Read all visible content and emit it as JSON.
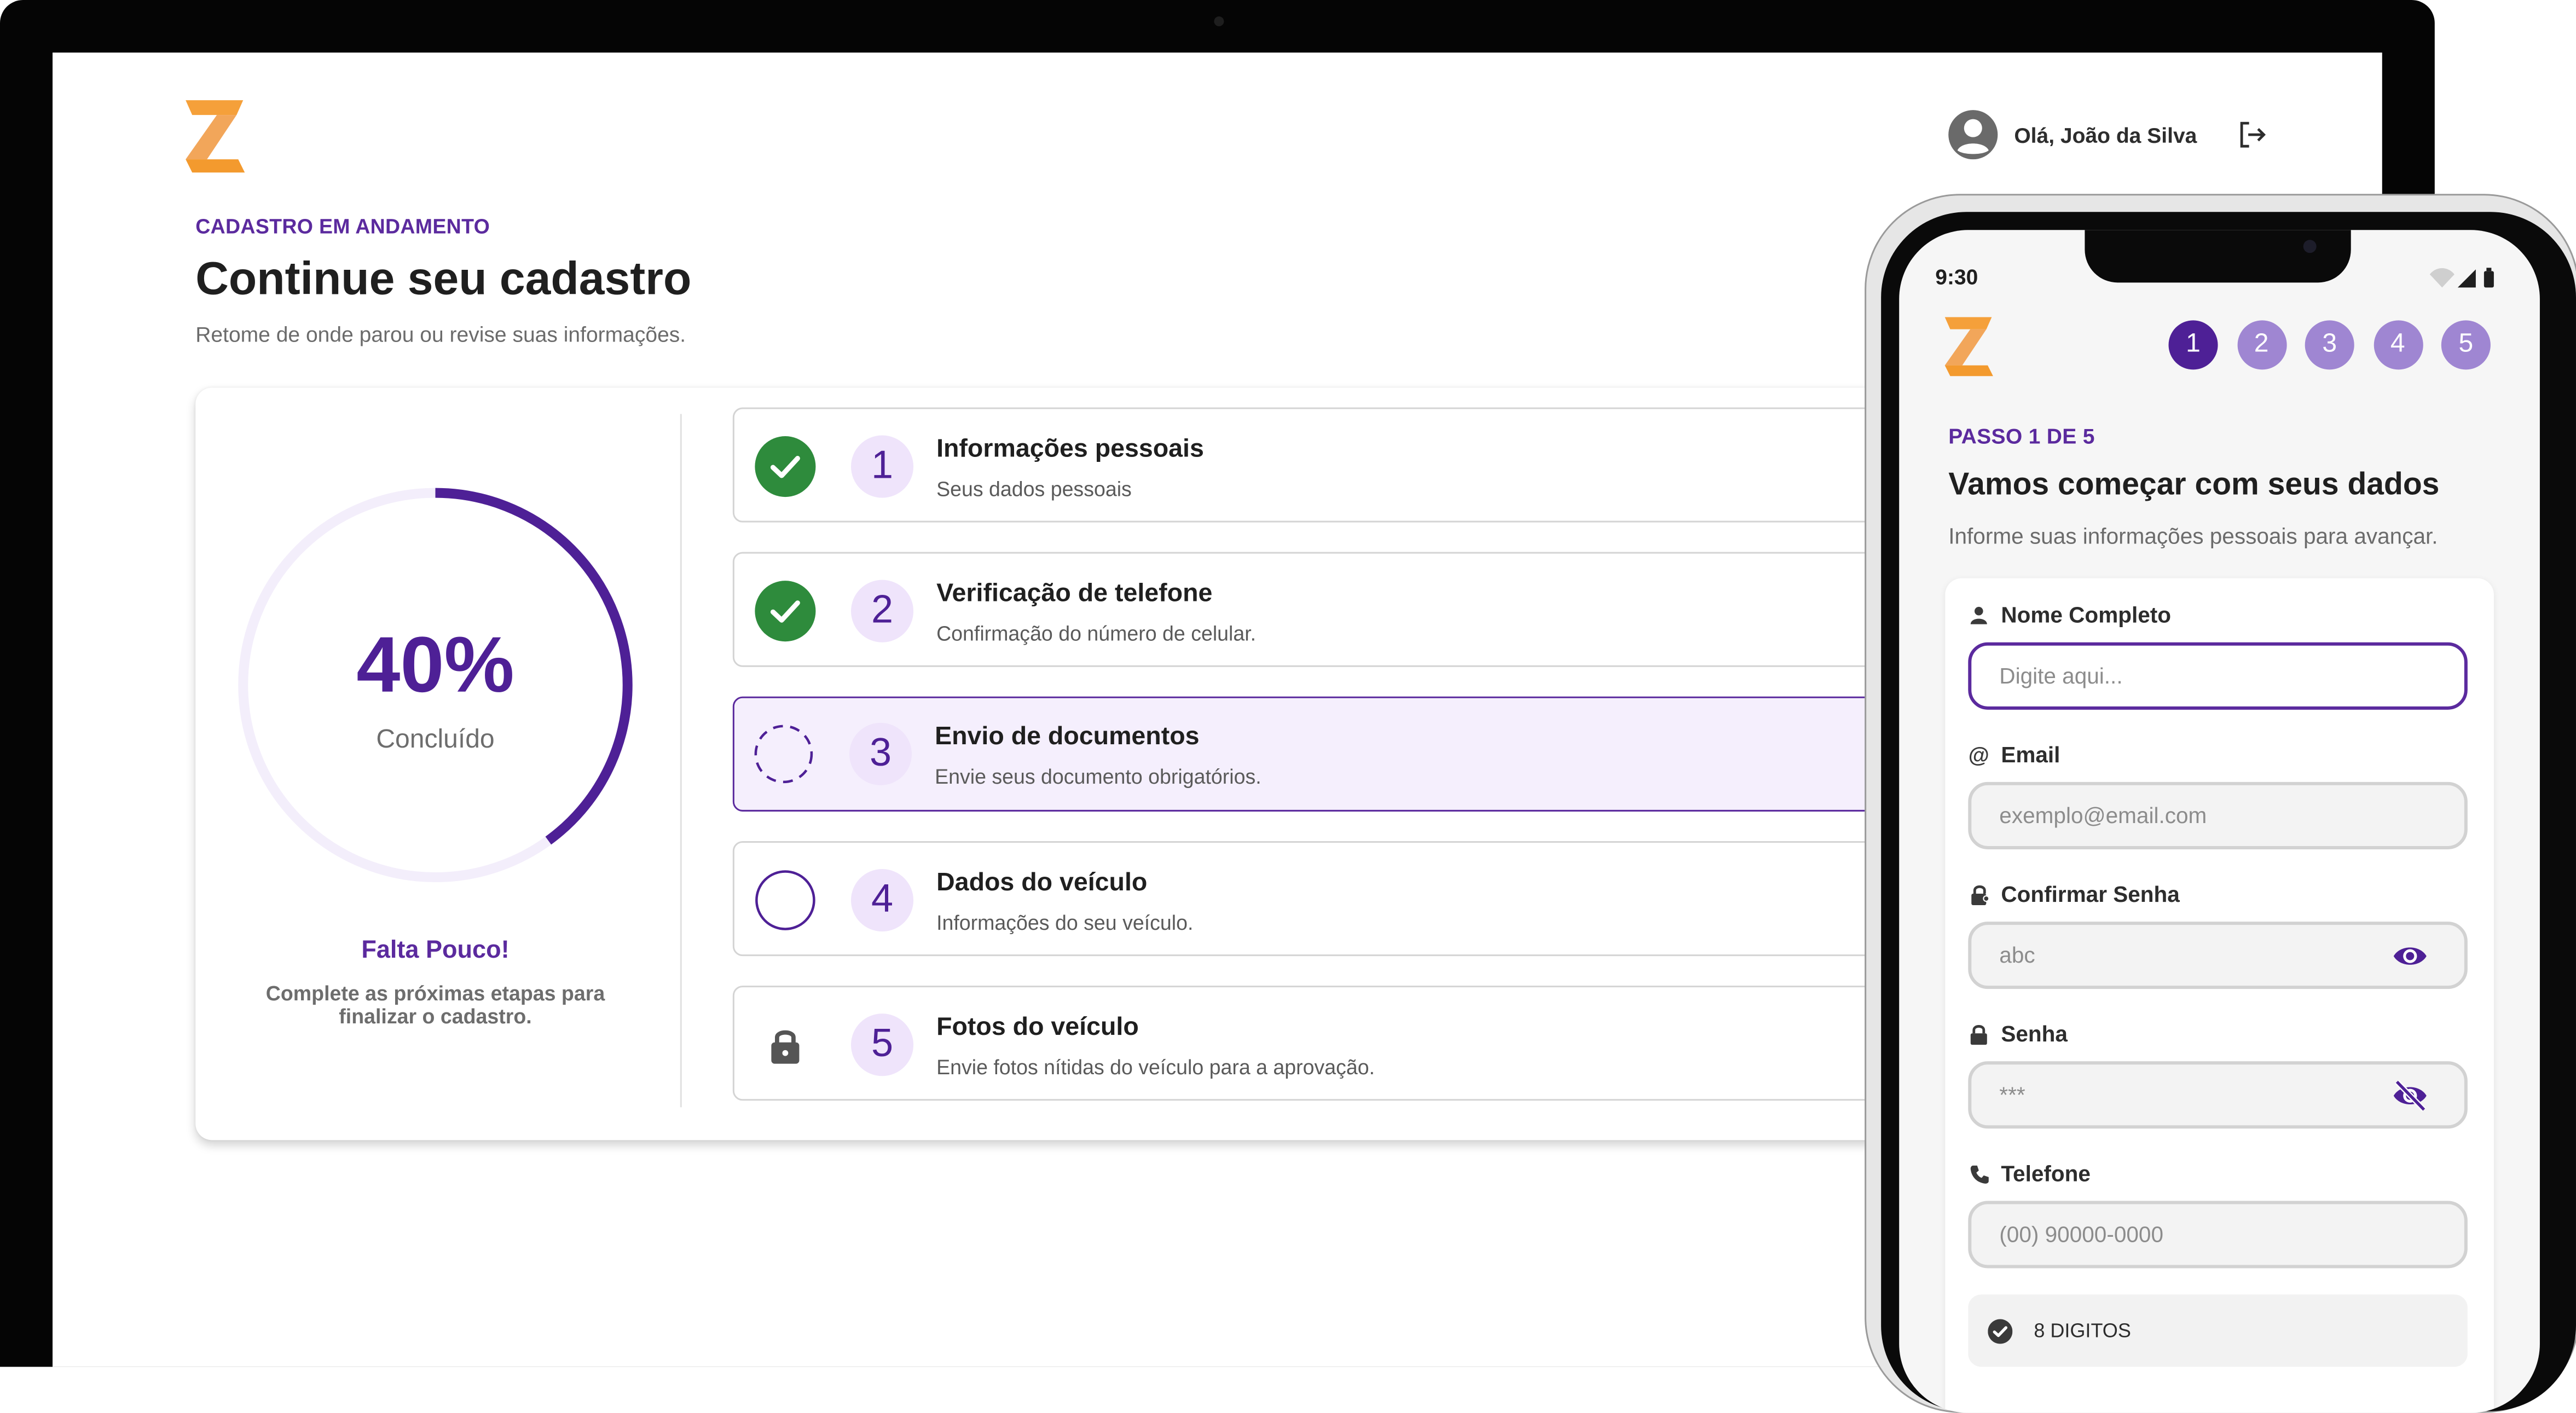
{
  "header": {
    "greeting": "Olá, João da Silva"
  },
  "desktop": {
    "eyebrow": "CADASTRO EM ANDAMENTO",
    "title": "Continue seu cadastro",
    "subtitle": "Retome de onde parou ou revise suas informações.",
    "progress": {
      "percent": 40,
      "percent_text": "40%",
      "label": "Concluído"
    },
    "encouragement": {
      "title": "Falta Pouco!",
      "text": "Complete as próximas etapas para finalizar o cadastro."
    },
    "steps": [
      {
        "num": "1",
        "title": "Informações pessoais",
        "desc": "Seus dados pessoais",
        "status": "done"
      },
      {
        "num": "2",
        "title": "Verificação de telefone",
        "desc": "Confirmação do número de celular.",
        "status": "done"
      },
      {
        "num": "3",
        "title": "Envio de documentos",
        "desc": "Envie seus documento obrigatórios.",
        "status": "in-progress"
      },
      {
        "num": "4",
        "title": "Dados do veículo",
        "desc": "Informações do seu veículo.",
        "status": "pending"
      },
      {
        "num": "5",
        "title": "Fotos do veículo",
        "desc": "Envie fotos nítidas do veículo para a aprovação.",
        "status": "locked"
      }
    ]
  },
  "mobile": {
    "time": "9:30",
    "stepper": [
      "1",
      "2",
      "3",
      "4",
      "5"
    ],
    "current_step": 1,
    "eyebrow": "PASSO 1 DE 5",
    "title": "Vamos começar com seus dados",
    "subtitle": "Informe suas informações pessoais para avançar.",
    "fields": {
      "name": {
        "label": "Nome Completo",
        "placeholder": "Digite aqui..."
      },
      "email": {
        "label": "Email",
        "placeholder": "exemplo@email.com"
      },
      "confirm_password": {
        "label": "Confirmar Senha",
        "value": "abc"
      },
      "password": {
        "label": "Senha",
        "value": "***"
      },
      "phone": {
        "label": "Telefone",
        "placeholder": "(00) 90000-0000"
      }
    },
    "requirement": "8 DIGITOS"
  },
  "colors": {
    "brand_purple": "#4e2096",
    "accent_orange": "#f39a2e",
    "success_green": "#2e8b3c"
  },
  "icons": [
    "user-circle-icon",
    "logout-icon",
    "check-circle-icon",
    "dashed-circle-icon",
    "empty-circle-icon",
    "lock-icon",
    "person-icon",
    "at-icon",
    "lock-person-icon",
    "phone-icon",
    "eye-icon",
    "eye-off-icon",
    "wifi-icon",
    "signal-icon",
    "battery-icon"
  ]
}
